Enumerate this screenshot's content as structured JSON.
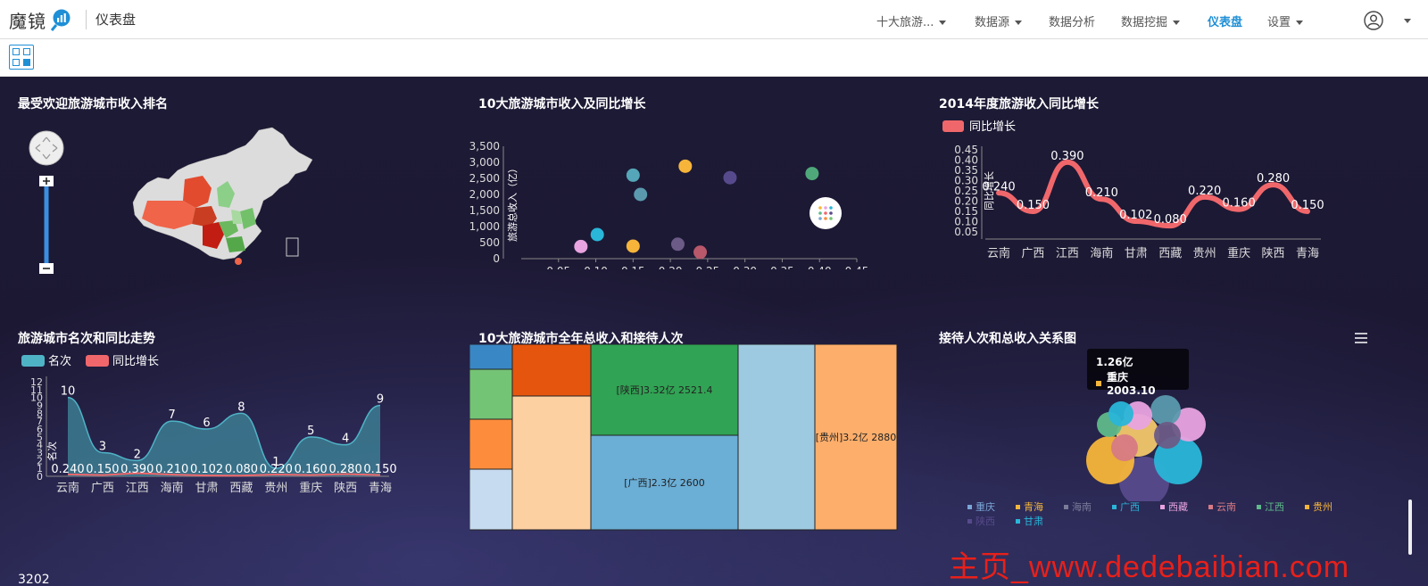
{
  "app": {
    "logo_text": "魔镜",
    "title": "仪表盘"
  },
  "nav": [
    {
      "label": "十大旅游...",
      "caret": true
    },
    {
      "label": "数据源",
      "caret": true
    },
    {
      "label": "数据分析",
      "caret": false
    },
    {
      "label": "数据挖掘",
      "caret": true
    },
    {
      "label": "仪表盘",
      "caret": false,
      "active": true
    },
    {
      "label": "设置",
      "caret": true
    }
  ],
  "colors": {
    "accent": "#1f8fd6",
    "background": "#1d1a35",
    "watermark": "#e8201a"
  },
  "panels": {
    "map": {
      "title": "最受欢迎旅游城市收入排名"
    },
    "scatter": {
      "title": "10大旅游城市收入及同比增长"
    },
    "line": {
      "title": "2014年度旅游收入同比增长"
    },
    "area": {
      "title": "旅游城市名次和同比走势"
    },
    "treemap": {
      "title": "10大旅游城市全年总收入和接待人次"
    },
    "bubble": {
      "title": "接待人次和总收入关系图"
    }
  },
  "tooltip": {
    "line1": "1.26亿",
    "line2": "重庆  2003.10"
  },
  "bottom_number": "3202",
  "watermark": "主页_www.dedebaibian.com",
  "chart_data": [
    {
      "type": "scatter",
      "ylabel": "旅游总收入（亿）",
      "xlim": [
        0,
        0.45
      ],
      "ylim": [
        0,
        3500
      ],
      "xticks": [
        "0.05",
        "0.10",
        "0.15",
        "0.20",
        "0.25",
        "0.30",
        "0.35",
        "0.40",
        "0.45"
      ],
      "yticks": [
        "0",
        "500",
        "1,000",
        "1,500",
        "2,000",
        "2,500",
        "3,000",
        "3,500"
      ],
      "points": [
        {
          "x": 0.08,
          "y": 380,
          "color": "#e8a3e0"
        },
        {
          "x": 0.102,
          "y": 750,
          "color": "#29b6d8"
        },
        {
          "x": 0.15,
          "y": 390,
          "color": "#f6b53a"
        },
        {
          "x": 0.15,
          "y": 2600,
          "color": "#55a6b8"
        },
        {
          "x": 0.16,
          "y": 2000,
          "color": "#5b9aae"
        },
        {
          "x": 0.21,
          "y": 450,
          "color": "#6b5b86"
        },
        {
          "x": 0.22,
          "y": 2880,
          "color": "#f6b53a"
        },
        {
          "x": 0.24,
          "y": 200,
          "color": "#b8586a"
        },
        {
          "x": 0.28,
          "y": 2521.4,
          "color": "#574a8c"
        },
        {
          "x": 0.39,
          "y": 2650,
          "color": "#4fa87a"
        }
      ]
    },
    {
      "type": "line",
      "legend": [
        "同比增长"
      ],
      "ylabel": "同比增长",
      "categories": [
        "云南",
        "广西",
        "江西",
        "海南",
        "甘肃",
        "西藏",
        "贵州",
        "重庆",
        "陕西",
        "青海"
      ],
      "values": [
        0.24,
        0.15,
        0.39,
        0.21,
        0.102,
        0.08,
        0.22,
        0.16,
        0.28,
        0.15
      ],
      "labels": [
        "0.240",
        "0.150",
        "0.390",
        "0.210",
        "0.102",
        "0.080",
        "0.220",
        "0.160",
        "0.280",
        "0.150"
      ],
      "yticks": [
        "0.05",
        "0.10",
        "0.15",
        "0.20",
        "0.25",
        "0.30",
        "0.35",
        "0.40",
        "0.45"
      ],
      "ylim": [
        0.05,
        0.45
      ],
      "color": "#f0676b"
    },
    {
      "type": "area",
      "legend": [
        "名次",
        "同比增长"
      ],
      "ylabel": "名次",
      "categories": [
        "云南",
        "广西",
        "江西",
        "海南",
        "甘肃",
        "西藏",
        "贵州",
        "重庆",
        "陕西",
        "青海"
      ],
      "series": [
        {
          "name": "名次",
          "values": [
            10,
            3,
            2,
            7,
            6,
            8,
            1,
            5,
            4,
            9
          ],
          "color": "#4fb3c6"
        },
        {
          "name": "同比增长",
          "values": [
            0.24,
            0.15,
            0.39,
            0.21,
            0.102,
            0.08,
            0.22,
            0.16,
            0.28,
            0.15
          ],
          "color": "#f0676b"
        }
      ],
      "rate_labels": [
        "0.240",
        "0.150",
        "0.390",
        "0.210",
        "0.102",
        "0.080",
        "0.220",
        "0.160",
        "0.280",
        "0.150"
      ],
      "yticks": [
        "0",
        "1",
        "2",
        "3",
        "4",
        "5",
        "6",
        "7",
        "8",
        "9",
        "10",
        "11",
        "12"
      ],
      "ylim": [
        0,
        12
      ]
    },
    {
      "type": "heatmap",
      "subtype": "treemap",
      "cells": [
        {
          "label": "",
          "color": "#3a87c5"
        },
        {
          "label": "",
          "color": "#74c476"
        },
        {
          "label": "",
          "color": "#fd8d3c"
        },
        {
          "label": "",
          "color": "#c6dbef"
        },
        {
          "label": "",
          "color": "#e6550d"
        },
        {
          "label": "",
          "color": "#fdd0a2"
        },
        {
          "label": "[陕西]3.32亿 2521.4",
          "color": "#31a354"
        },
        {
          "label": "[广西]2.3亿 2600",
          "color": "#6baed6"
        },
        {
          "label": "",
          "color": "#9ecae1"
        },
        {
          "label": "[贵州]3.2亿 2880",
          "color": "#fdae6b"
        }
      ]
    },
    {
      "type": "scatter",
      "subtype": "bubble",
      "legend": [
        {
          "name": "重庆",
          "color": "#7aa6d6"
        },
        {
          "name": "青海",
          "color": "#f2b63c"
        },
        {
          "name": "海南",
          "color": "#7b7b9a"
        },
        {
          "name": "广西",
          "color": "#29b6d8"
        },
        {
          "name": "西藏",
          "color": "#e8a3e0"
        },
        {
          "name": "云南",
          "color": "#d77a84"
        },
        {
          "name": "江西",
          "color": "#5fba8a"
        },
        {
          "name": "贵州",
          "color": "#f6b53a"
        },
        {
          "name": "陕西",
          "color": "#574a8c"
        },
        {
          "name": "甘肃",
          "color": "#29b6d8"
        }
      ],
      "bubbles": [
        {
          "color": "#574a8c",
          "size": 1.0
        },
        {
          "color": "#29b6d8",
          "size": 0.95
        },
        {
          "color": "#f6b53a",
          "size": 0.95
        },
        {
          "color": "#f2c76a",
          "size": 0.8
        },
        {
          "color": "#e8a3e0",
          "size": 0.55
        },
        {
          "color": "#5b9aae",
          "size": 0.45
        },
        {
          "color": "#e8a3e0",
          "size": 0.4
        },
        {
          "color": "#6b5b86",
          "size": 0.35
        },
        {
          "color": "#5fba8a",
          "size": 0.3
        },
        {
          "color": "#29b6d8",
          "size": 0.3
        },
        {
          "color": "#d77a84",
          "size": 0.35
        }
      ]
    }
  ]
}
